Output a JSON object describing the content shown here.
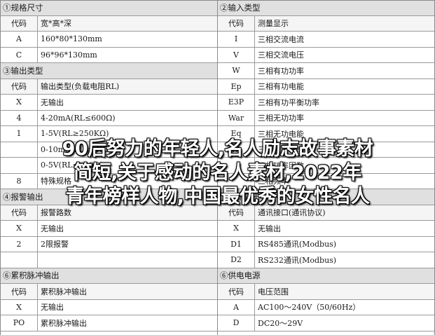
{
  "left": [
    {
      "type": "sec",
      "text": "①规格尺寸"
    },
    {
      "type": "hdr",
      "code": "代码",
      "desc": "宽*高*深"
    },
    {
      "type": "row",
      "code": "A",
      "desc": "160*80*130mm"
    },
    {
      "type": "row",
      "code": "C",
      "desc": "96*96*130mm"
    },
    {
      "type": "sec",
      "text": "③输出类型"
    },
    {
      "type": "hdr",
      "code": "代码",
      "desc": "输出类型(负载电阻RL)"
    },
    {
      "type": "row",
      "code": "X",
      "desc": "无输出"
    },
    {
      "type": "row",
      "code": "4",
      "desc": "4-20mA(RL≤600Ω)"
    },
    {
      "type": "row",
      "code": "1",
      "desc": "1-5V(RL≥250KΩ)"
    },
    {
      "type": "row",
      "code": "",
      "desc": "0-10mA(RL≤1KΩ)"
    },
    {
      "type": "row",
      "code": "",
      "desc": "0-5V(RL≤600Ω)"
    },
    {
      "type": "row",
      "code": "8",
      "desc": "特殊规格"
    },
    {
      "type": "sec",
      "text": "④报警输出"
    },
    {
      "type": "hdr",
      "code": "代码",
      "desc": "报警路数"
    },
    {
      "type": "row",
      "code": "X",
      "desc": "无输出"
    },
    {
      "type": "row",
      "code": "2",
      "desc": "2限报警"
    },
    {
      "type": "row",
      "code": "",
      "desc": ""
    },
    {
      "type": "sec",
      "text": "⑥累积脉冲输出"
    },
    {
      "type": "hdr",
      "code": "代码",
      "desc": "累积脉冲输出"
    },
    {
      "type": "row",
      "code": "X",
      "desc": "无输出"
    },
    {
      "type": "row",
      "code": "PO",
      "desc": "累积脉冲输出"
    }
  ],
  "right": [
    {
      "type": "sec",
      "text": "②输入类型"
    },
    {
      "type": "hdr",
      "code": "代码",
      "desc": "测量显示"
    },
    {
      "type": "row",
      "code": "I",
      "desc": "三相交流电流"
    },
    {
      "type": "row",
      "code": "V",
      "desc": "三相交流电压"
    },
    {
      "type": "row",
      "code": "W",
      "desc": "三相有功功率"
    },
    {
      "type": "row",
      "code": "Ep",
      "desc": "三相有功电能"
    },
    {
      "type": "row",
      "code": "E3P",
      "desc": "三相有功平衡功率"
    },
    {
      "type": "row",
      "code": "War",
      "desc": "三相无功功率"
    },
    {
      "type": "row",
      "code": "Eq",
      "desc": "三相无功电能"
    },
    {
      "type": "row",
      "code": "VA",
      "desc": "三相视在功率"
    },
    {
      "type": "row",
      "code": "",
      "desc": "三相功率因数"
    },
    {
      "type": "row",
      "code": "",
      "desc": "三相频率"
    },
    {
      "type": "sec",
      "text": "⑤通讯输出"
    },
    {
      "type": "hdr",
      "code": "代码",
      "desc": "通讯接口(通讯协议)"
    },
    {
      "type": "row",
      "code": "X",
      "desc": "无输出"
    },
    {
      "type": "row",
      "code": "D1",
      "desc": "RS485通讯(Modbus)"
    },
    {
      "type": "row",
      "code": "D2",
      "desc": "RS232通讯(Modbus)"
    },
    {
      "type": "sec",
      "text": "⑥供电电源"
    },
    {
      "type": "hdr",
      "code": "代码",
      "desc": "电压范围"
    },
    {
      "type": "row",
      "code": "A",
      "desc": "AC100～240V（50/60Hz）"
    },
    {
      "type": "row",
      "code": "D",
      "desc": "DC20～29V"
    }
  ],
  "watermark": [
    "90后努力的年轻人,名人励志故事素材",
    "简短,关于感动的名人素材,2022年",
    "青年榜样人物,中国最优秀的女性名人"
  ]
}
